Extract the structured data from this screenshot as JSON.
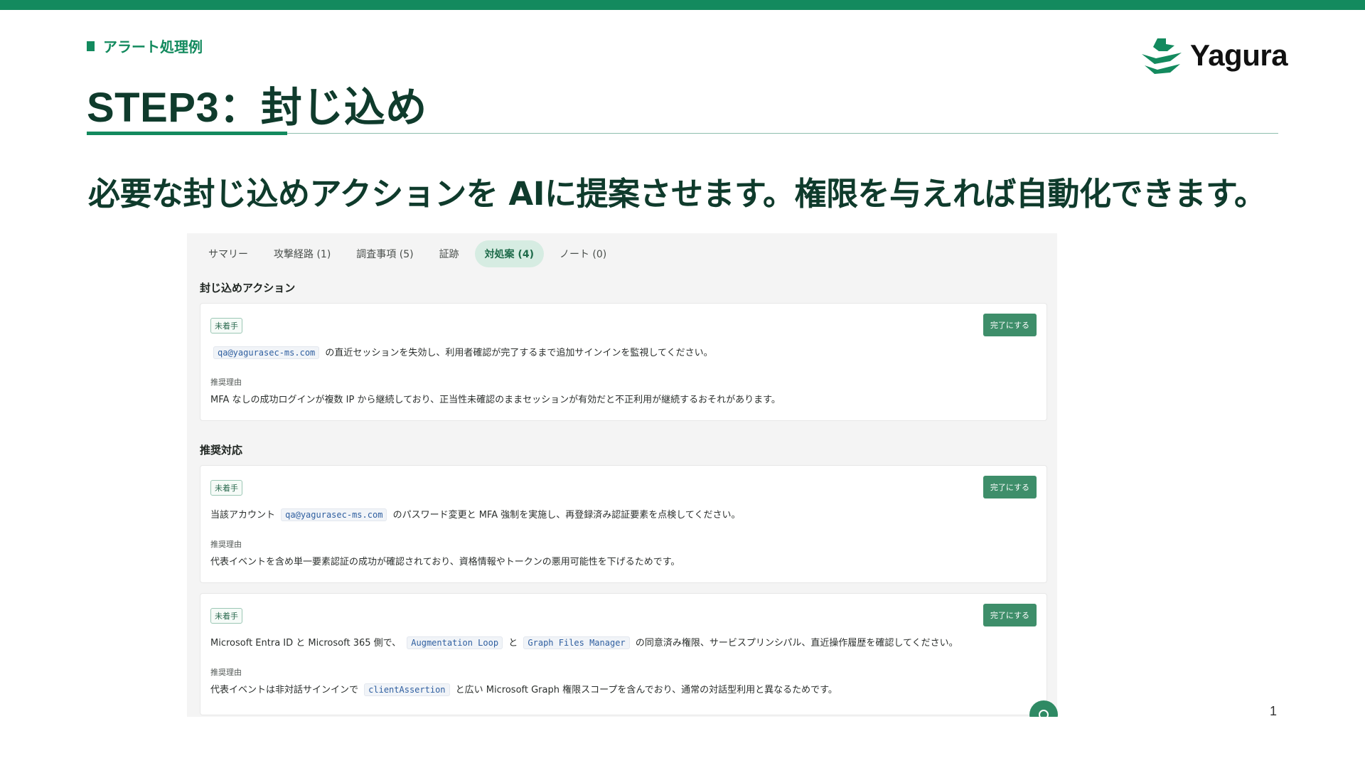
{
  "slide": {
    "section_tag": "アラート処理例",
    "title": "STEP3：封じ込め",
    "headline": "必要な封じ込めアクションを AIに提案させます。権限を与えれば自動化できます。",
    "page_number": "1",
    "logo_text": "Yagura",
    "accent_color": "#138a5e"
  },
  "tabs": [
    {
      "label": "サマリー",
      "active": false
    },
    {
      "label": "攻撃経路 (1)",
      "active": false
    },
    {
      "label": "調査事項 (5)",
      "active": false
    },
    {
      "label": "証跡",
      "active": false
    },
    {
      "label": "対処案 (4)",
      "active": true
    },
    {
      "label": "ノート (0)",
      "active": false
    }
  ],
  "containment": {
    "heading": "封じ込めアクション",
    "card": {
      "status": "未着手",
      "action_button": "完了にする",
      "code1": "qa@yagurasec-ms.com",
      "text_after": "の直近セッションを失効し、利用者確認が完了するまで追加サインインを監視してください。",
      "reason_label": "推奨理由",
      "reason": "MFA なしの成功ログインが複数 IP から継続しており、正当性未確認のままセッションが有効だと不正利用が継続するおそれがあります。"
    }
  },
  "recommended": {
    "heading": "推奨対応",
    "cards": [
      {
        "status": "未着手",
        "action_button": "完了にする",
        "text_before": "当該アカウント",
        "code1": "qa@yagurasec-ms.com",
        "text_after": "のパスワード変更と MFA 強制を実施し、再登録済み認証要素を点検してください。",
        "reason_label": "推奨理由",
        "reason": "代表イベントを含め単一要素認証の成功が確認されており、資格情報やトークンの悪用可能性を下げるためです。"
      },
      {
        "status": "未着手",
        "action_button": "完了にする",
        "text_before": "Microsoft Entra ID と Microsoft 365 側で、",
        "code1": "Augmentation Loop",
        "text_mid": "と",
        "code2": "Graph Files Manager",
        "text_after": "の同意済み権限、サービスプリンシパル、直近操作履歴を確認してください。",
        "reason_label": "推奨理由",
        "reason_before": "代表イベントは非対話サインインで",
        "reason_code": "clientAssertion",
        "reason_after": "と広い Microsoft Graph 権限スコープを含んでおり、通常の対話型利用と異なるためです。"
      }
    ]
  }
}
